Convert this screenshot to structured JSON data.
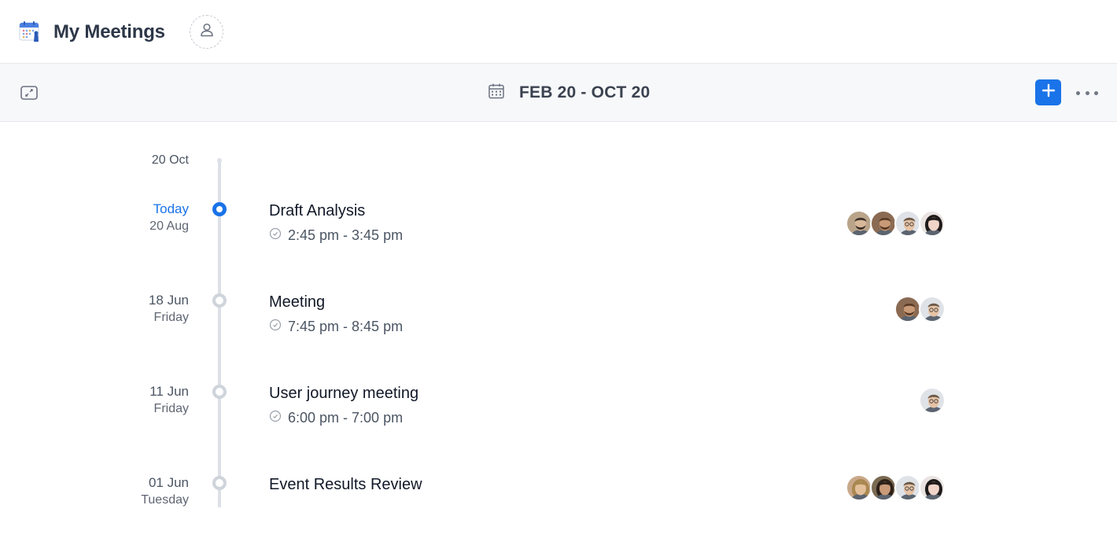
{
  "header": {
    "title": "My Meetings",
    "app_icon": "calendar-app-icon",
    "user_icon": "user-icon"
  },
  "toolbar": {
    "date_range": "FEB 20 - OCT 20",
    "calendar_icon": "calendar-icon",
    "expand_icon": "expand-icon",
    "add_icon": "plus-icon",
    "more_icon": "more-horizontal-icon",
    "accent_color": "#1a73e8"
  },
  "timeline": {
    "start_date": "20 Oct",
    "events": [
      {
        "date_line1": "Today",
        "date_line2": "20 Aug",
        "is_today": true,
        "title": "Draft Analysis",
        "time": "2:45 pm - 3:45 pm",
        "attendees": [
          "attendee-1",
          "attendee-2",
          "attendee-3",
          "attendee-4"
        ]
      },
      {
        "date_line1": "18 Jun",
        "date_line2": "Friday",
        "is_today": false,
        "title": "Meeting",
        "time": "7:45 pm - 8:45 pm",
        "attendees": [
          "attendee-2",
          "attendee-3"
        ]
      },
      {
        "date_line1": "11 Jun",
        "date_line2": "Friday",
        "is_today": false,
        "title": "User journey meeting",
        "time": "6:00 pm - 7:00 pm",
        "attendees": [
          "attendee-3"
        ]
      },
      {
        "date_line1": "01 Jun",
        "date_line2": "Tuesday",
        "is_today": false,
        "title": "Event Results Review",
        "time": "",
        "attendees": [
          "attendee-5",
          "attendee-6",
          "attendee-3",
          "attendee-4"
        ]
      }
    ]
  }
}
